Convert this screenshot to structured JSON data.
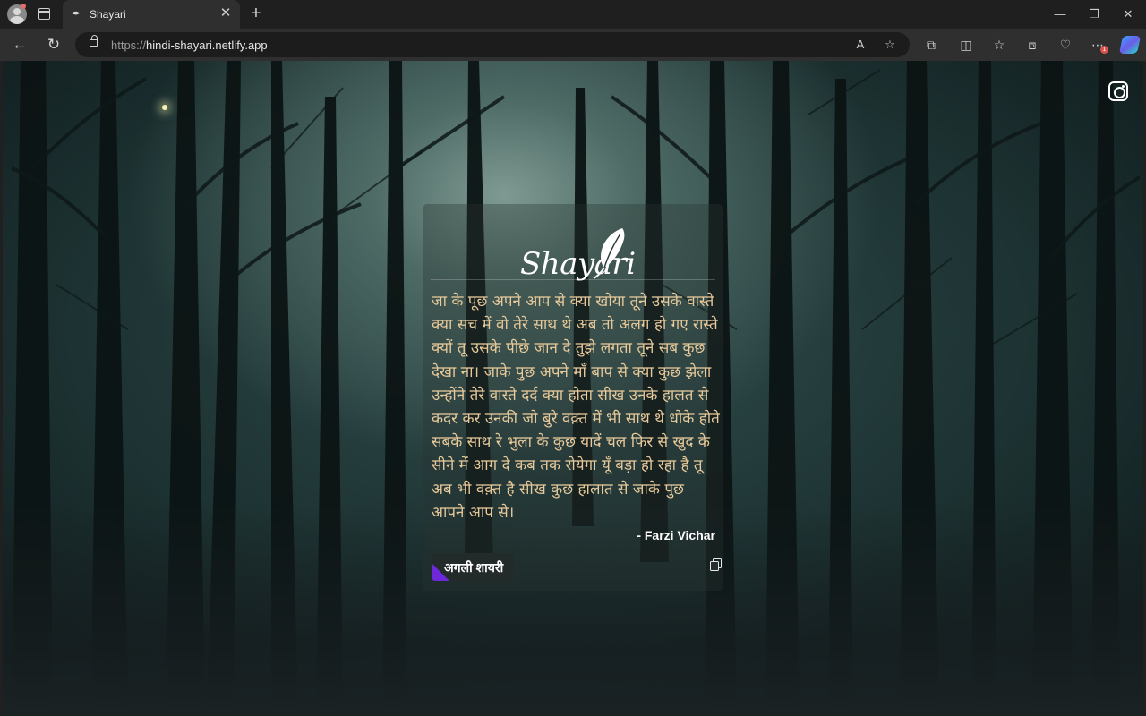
{
  "browser": {
    "tab_title": "Shayari",
    "url_scheme": "https://",
    "url_host": "hindi-shayari.netlify.app",
    "notification_count": "1"
  },
  "icons": {
    "profile": "profile-avatar-icon",
    "workspaces": "workspaces-icon",
    "favicon": "quill-favicon-icon",
    "back": "back-arrow-icon",
    "refresh": "refresh-icon",
    "lock": "lock-icon",
    "read_aloud": "read-aloud-icon",
    "favorite": "star-icon",
    "extensions": "puzzle-icon",
    "split": "split-screen-icon",
    "favorites": "favorites-icon",
    "collections": "collections-icon",
    "performance": "heart-pulse-icon",
    "more": "more-icon",
    "copilot": "copilot-icon",
    "instagram": "instagram-icon",
    "copy": "copy-icon"
  },
  "page": {
    "logo_text": "Shayari",
    "shayari_text": "जा के पूछ अपने आप से क्या खोया तूने उसके वास्ते क्या सच में वो तेरे साथ थे अब तो अलग हो गए रास्ते क्यों तू उसके पीछे जान दे तुझे लगता तूने सब कुछ देखा ना। जाके पुछ अपने माँ बाप से क्या कुछ झेला उन्होंने तेरे वास्ते दर्द क्या होता सीख उनके हालत से कदर कर उनकी जो बुरे वक़्त में भी साथ थे धोके होते सबके साथ रे भुला के कुछ यादें चल फिर से खुद के सीने में आग दे कब तक रोयेगा यूँ बड़ा हो रहा है तू अब भी वक़्त है सीख कुछ हालात से जाके पुछ आपने आप से।",
    "author": "- Farzi Vichar",
    "next_button": "अगली शायरी"
  }
}
